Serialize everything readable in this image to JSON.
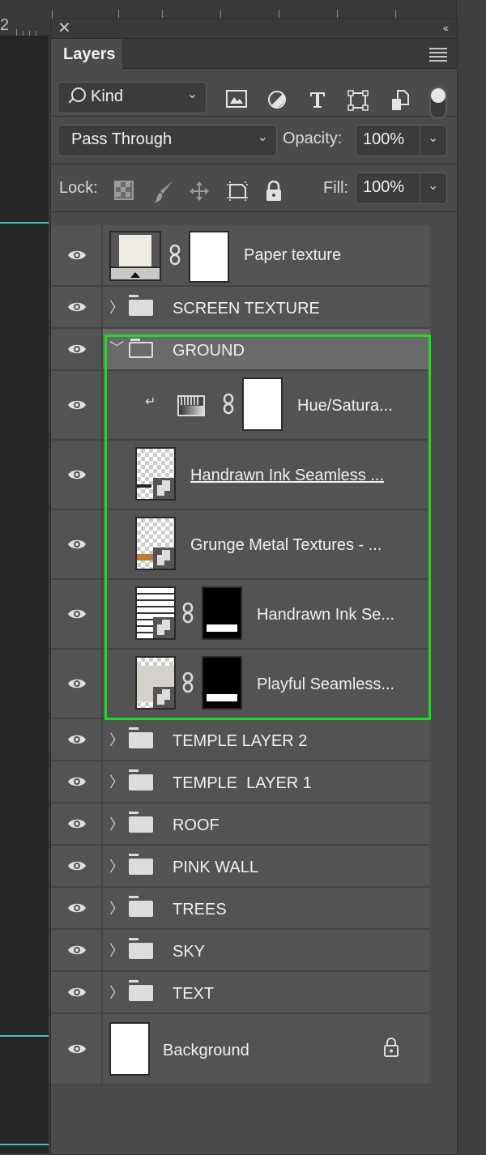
{
  "ruler": {
    "label": "2"
  },
  "panel": {
    "title": "Layers",
    "close_icon": "close-icon",
    "collapse_icon": "double-chevron-left-icon",
    "menu_icon": "hamburger-menu-icon"
  },
  "filter": {
    "kind_label": "Kind",
    "icons": [
      "image-filter-icon",
      "adjustment-filter-icon",
      "type-filter-icon",
      "shape-filter-icon",
      "smart-object-filter-icon"
    ],
    "toggle_on": true
  },
  "blend": {
    "mode": "Pass Through",
    "opacity_label": "Opacity:",
    "opacity_value": "100%"
  },
  "lock": {
    "label": "Lock:",
    "icons": [
      "lock-transparent-pixels-icon",
      "lock-image-pixels-icon",
      "lock-position-icon",
      "lock-artboard-icon",
      "lock-all-icon"
    ],
    "fill_label": "Fill:",
    "fill_value": "100%"
  },
  "layers": [
    {
      "name": "Paper texture",
      "type": "adjustment-fill",
      "mask": "white",
      "visible": true
    },
    {
      "name": "SCREEN TEXTURE",
      "type": "group",
      "expanded": false,
      "visible": true
    },
    {
      "name": "GROUND",
      "type": "group",
      "expanded": true,
      "selected": true,
      "visible": true
    },
    {
      "name": "Hue/Satura...",
      "type": "adjustment",
      "clipped": true,
      "mask": "white",
      "visible": true
    },
    {
      "name": "Handrawn Ink Seamless ...",
      "type": "smart-object",
      "underlined": true,
      "visible": true
    },
    {
      "name": "Grunge Metal Textures - ...",
      "type": "smart-object",
      "visible": true
    },
    {
      "name": "Handrawn Ink Se...",
      "type": "smart-object",
      "mask": "black",
      "visible": true
    },
    {
      "name": "Playful Seamless...",
      "type": "smart-object",
      "mask": "black",
      "visible": true
    },
    {
      "name": "TEMPLE LAYER 2",
      "type": "group",
      "expanded": false,
      "visible": true
    },
    {
      "name": "TEMPLE  LAYER 1",
      "type": "group",
      "expanded": false,
      "visible": true
    },
    {
      "name": "ROOF",
      "type": "group",
      "expanded": false,
      "visible": true
    },
    {
      "name": "PINK WALL",
      "type": "group",
      "expanded": false,
      "visible": true
    },
    {
      "name": "TREES",
      "type": "group",
      "expanded": false,
      "visible": true
    },
    {
      "name": "SKY",
      "type": "group",
      "expanded": false,
      "visible": true
    },
    {
      "name": "TEXT",
      "type": "group",
      "expanded": false,
      "visible": true
    },
    {
      "name": "Background",
      "type": "background",
      "locked": true,
      "visible": true
    }
  ],
  "colors": {
    "highlight_outline": "#1fdc1f",
    "guide_line": "#3fc4c8",
    "panel_bg": "#4b4b4b",
    "selected_row": "#6a6a6a"
  }
}
